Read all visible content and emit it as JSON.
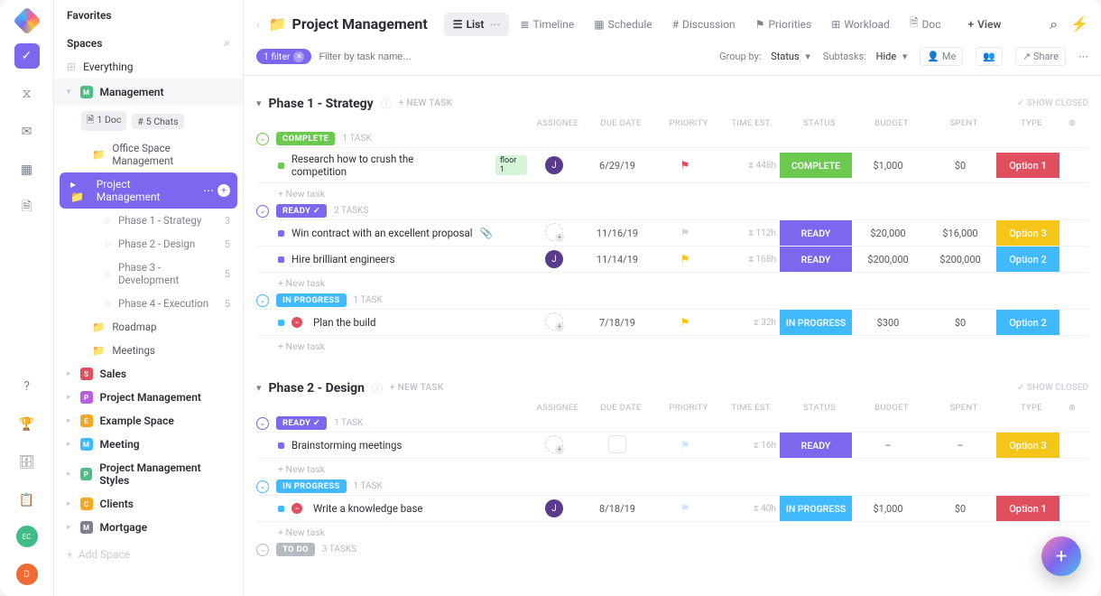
{
  "rail": {
    "avatar1": "EC",
    "avatar2": "D"
  },
  "sidebar": {
    "favorites": "Favorites",
    "spaces": "Spaces",
    "everything": "Everything",
    "management": "Management",
    "doc_chip": "1 Doc",
    "chats_chip": "5 Chats",
    "tree": {
      "office": "Office Space Management",
      "pm": "Project Management",
      "phases": [
        {
          "label": "Phase 1 - Strategy",
          "count": "3"
        },
        {
          "label": "Phase 2 - Design",
          "count": "5"
        },
        {
          "label": "Phase 3 - Development",
          "count": "5"
        },
        {
          "label": "Phase 4 - Execution",
          "count": "5"
        }
      ],
      "roadmap": "Roadmap",
      "meetings": "Meetings"
    },
    "spaces_list": [
      {
        "letter": "S",
        "color": "#e04f5f",
        "label": "Sales"
      },
      {
        "letter": "P",
        "color": "#b660e0",
        "label": "Project Management"
      },
      {
        "letter": "E",
        "color": "#f5a623",
        "label": "Example Space"
      },
      {
        "letter": "M",
        "color": "#41b9ff",
        "label": "Meeting"
      },
      {
        "letter": "P",
        "color": "#4fbc86",
        "label": "Project Management Styles"
      },
      {
        "letter": "C",
        "color": "#f5a623",
        "label": "Clients"
      },
      {
        "letter": "M",
        "color": "#7c828d",
        "label": "Mortgage"
      }
    ],
    "add_space": "Add Space"
  },
  "header": {
    "title": "Project Management",
    "views": [
      {
        "icon": "☰",
        "label": "List",
        "active": true,
        "ellipsis": true
      },
      {
        "icon": "≣",
        "label": "Timeline"
      },
      {
        "icon": "▦",
        "label": "Schedule"
      },
      {
        "icon": "#",
        "label": "Discussion"
      },
      {
        "icon": "⚑",
        "label": "Priorities"
      },
      {
        "icon": "⊞",
        "label": "Workload"
      },
      {
        "icon": "🗎",
        "label": "Doc"
      }
    ],
    "add_view": "View"
  },
  "filterbar": {
    "pill": "1 filter",
    "placeholder": "Filter by task name...",
    "groupby_label": "Group by:",
    "groupby_value": "Status",
    "subtasks_label": "Subtasks:",
    "subtasks_value": "Hide",
    "me": "Me",
    "share": "Share"
  },
  "columns": [
    "ASSIGNEE",
    "DUE DATE",
    "PRIORITY",
    "TIME EST.",
    "STATUS",
    "BUDGET",
    "SPENT",
    "TYPE"
  ],
  "phases": [
    {
      "title": "Phase 1 - Strategy",
      "new_task": "+ NEW TASK",
      "show_closed": "SHOW CLOSED",
      "groups": [
        {
          "status": "COMPLETE",
          "status_color": "#6bc950",
          "count": "1 TASK",
          "tasks": [
            {
              "dot": "#6bc950",
              "name": "Research how to crush the competition",
              "sub": "floor 1",
              "sub_color": "#d6f5d6",
              "av_type": "j",
              "due": "6/29/19",
              "due_cls": "due-red",
              "flag": "#e04f5f",
              "est": "448h",
              "status": "COMPLETE",
              "status_bg": "#6bc950",
              "budget": "$1,000",
              "spent": "$0",
              "type": "Option 1",
              "type_bg": "#e04f5f"
            }
          ]
        },
        {
          "status": "READY",
          "status_color": "#7b68ee",
          "count": "2 TASKS",
          "check": true,
          "tasks": [
            {
              "dot": "#7b68ee",
              "name": "Win contract with an excellent proposal",
              "clip": true,
              "av_type": "dash",
              "due": "11/16/19",
              "due_cls": "due-green",
              "flag": "#d0d3d9",
              "est": "112h",
              "status": "READY",
              "status_bg": "#7b68ee",
              "budget": "$20,000",
              "spent": "$16,000",
              "type": "Option 3",
              "type_bg": "#f5c518"
            },
            {
              "dot": "#7b68ee",
              "name": "Hire brilliant engineers",
              "av_type": "j",
              "due": "11/14/19",
              "due_cls": "due-red",
              "flag": "#f5c518",
              "est": "168h",
              "status": "READY",
              "status_bg": "#7b68ee",
              "budget": "$200,000",
              "spent": "$200,000",
              "type": "Option 2",
              "type_bg": "#41b9ff"
            }
          ]
        },
        {
          "status": "IN PROGRESS",
          "status_color": "#41b9ff",
          "count": "1 TASK",
          "tasks": [
            {
              "dot": "#41b9ff",
              "no_sign": true,
              "name": "Plan the build",
              "av_type": "dash",
              "due": "7/18/19",
              "due_cls": "due-red",
              "flag": "#f5c518",
              "est": "32h",
              "status": "IN PROGRESS",
              "status_bg": "#41b9ff",
              "budget": "$300",
              "spent": "$0",
              "type": "Option 2",
              "type_bg": "#41b9ff"
            }
          ]
        }
      ]
    },
    {
      "title": "Phase 2 - Design",
      "new_task": "+ NEW TASK",
      "show_closed": "SHOW CLOSED",
      "groups": [
        {
          "status": "READY",
          "status_color": "#7b68ee",
          "count": "1 TASK",
          "check": true,
          "tasks": [
            {
              "dot": "#7b68ee",
              "name": "Brainstorming meetings",
              "av_type": "dash",
              "due_box": true,
              "flag": "#cfe3ff",
              "est": "16h",
              "status": "READY",
              "status_bg": "#7b68ee",
              "budget": "–",
              "spent": "–",
              "type": "Option 3",
              "type_bg": "#f5c518"
            }
          ]
        },
        {
          "status": "IN PROGRESS",
          "status_color": "#41b9ff",
          "count": "1 TASK",
          "tasks": [
            {
              "dot": "#41b9ff",
              "no_sign": true,
              "name": "Write a knowledge base",
              "av_type": "j",
              "due": "8/18/19",
              "due_cls": "due-red",
              "flag": "#cfe3ff",
              "est": "40h",
              "status": "IN PROGRESS",
              "status_bg": "#41b9ff",
              "budget": "$1,000",
              "spent": "$0",
              "type": "Option 1",
              "type_bg": "#e04f5f"
            }
          ]
        },
        {
          "status": "TO DO",
          "status_color": "#b5b9c0",
          "count": "3 TASKS",
          "muted": true,
          "tasks": []
        }
      ]
    }
  ],
  "labels": {
    "new_task_row": "+ New task"
  }
}
